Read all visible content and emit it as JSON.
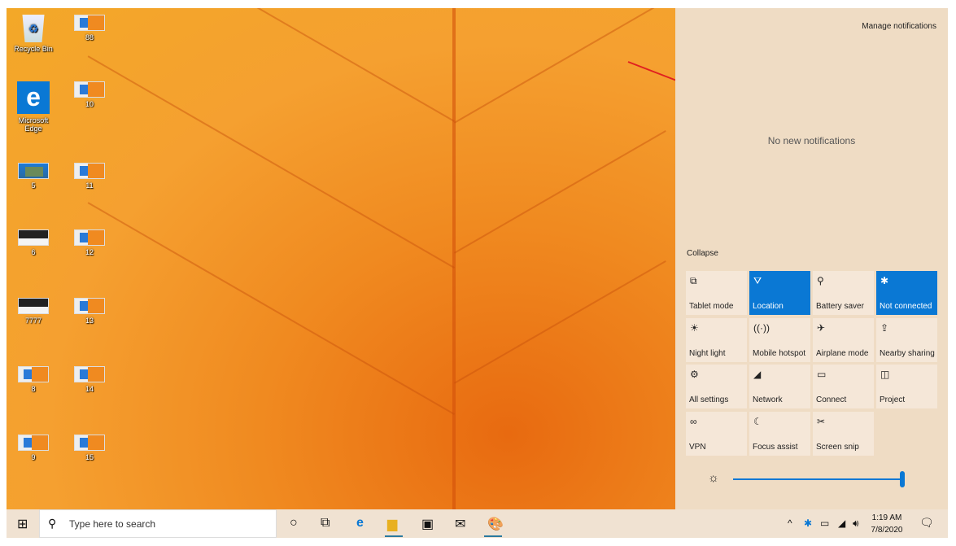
{
  "desktop": {
    "icons": [
      {
        "label": "Recycle Bin",
        "type": "recycle"
      },
      {
        "label": "88",
        "type": "thumb"
      },
      {
        "label": "Microsoft Edge",
        "type": "edge"
      },
      {
        "label": "10",
        "type": "thumb"
      },
      {
        "label": "5",
        "type": "photo"
      },
      {
        "label": "11",
        "type": "thumb"
      },
      {
        "label": "6",
        "type": "dark"
      },
      {
        "label": "12",
        "type": "thumb"
      },
      {
        "label": "7777",
        "type": "dark"
      },
      {
        "label": "13",
        "type": "thumb"
      },
      {
        "label": "8",
        "type": "thumb"
      },
      {
        "label": "14",
        "type": "thumb"
      },
      {
        "label": "9",
        "type": "thumb"
      },
      {
        "label": "15",
        "type": "thumb"
      }
    ]
  },
  "action_center": {
    "manage": "Manage notifications",
    "empty": "No new notifications",
    "collapse": "Collapse",
    "tiles": [
      {
        "label": "Tablet mode",
        "icon": "tablet-icon",
        "glyph": "⧉",
        "on": false
      },
      {
        "label": "Location",
        "icon": "location-icon",
        "glyph": "⛛",
        "on": true
      },
      {
        "label": "Battery saver",
        "icon": "battery-saver-icon",
        "glyph": "⚲",
        "on": false
      },
      {
        "label": "Not connected",
        "icon": "bluetooth-icon",
        "glyph": "✱",
        "on": true
      },
      {
        "label": "Night light",
        "icon": "night-light-icon",
        "glyph": "☀",
        "on": false
      },
      {
        "label": "Mobile hotspot",
        "icon": "hotspot-icon",
        "glyph": "((·))",
        "on": false
      },
      {
        "label": "Airplane mode",
        "icon": "airplane-icon",
        "glyph": "✈",
        "on": false
      },
      {
        "label": "Nearby sharing",
        "icon": "nearby-sharing-icon",
        "glyph": "⇪",
        "on": false
      },
      {
        "label": "All settings",
        "icon": "settings-icon",
        "glyph": "⚙",
        "on": false
      },
      {
        "label": "Network",
        "icon": "network-icon",
        "glyph": "◢",
        "on": false
      },
      {
        "label": "Connect",
        "icon": "connect-icon",
        "glyph": "▭",
        "on": false
      },
      {
        "label": "Project",
        "icon": "project-icon",
        "glyph": "◫",
        "on": false
      },
      {
        "label": "VPN",
        "icon": "vpn-icon",
        "glyph": "∞",
        "on": false
      },
      {
        "label": "Focus assist",
        "icon": "moon-icon",
        "glyph": "☾",
        "on": false
      },
      {
        "label": "Screen snip",
        "icon": "screen-snip-icon",
        "glyph": "✂",
        "on": false
      }
    ],
    "brightness_percent": 100,
    "accent": "#0a78d4"
  },
  "taskbar": {
    "search_placeholder": "Type here to search",
    "time": "1:19 AM",
    "date": "7/8/2020"
  }
}
